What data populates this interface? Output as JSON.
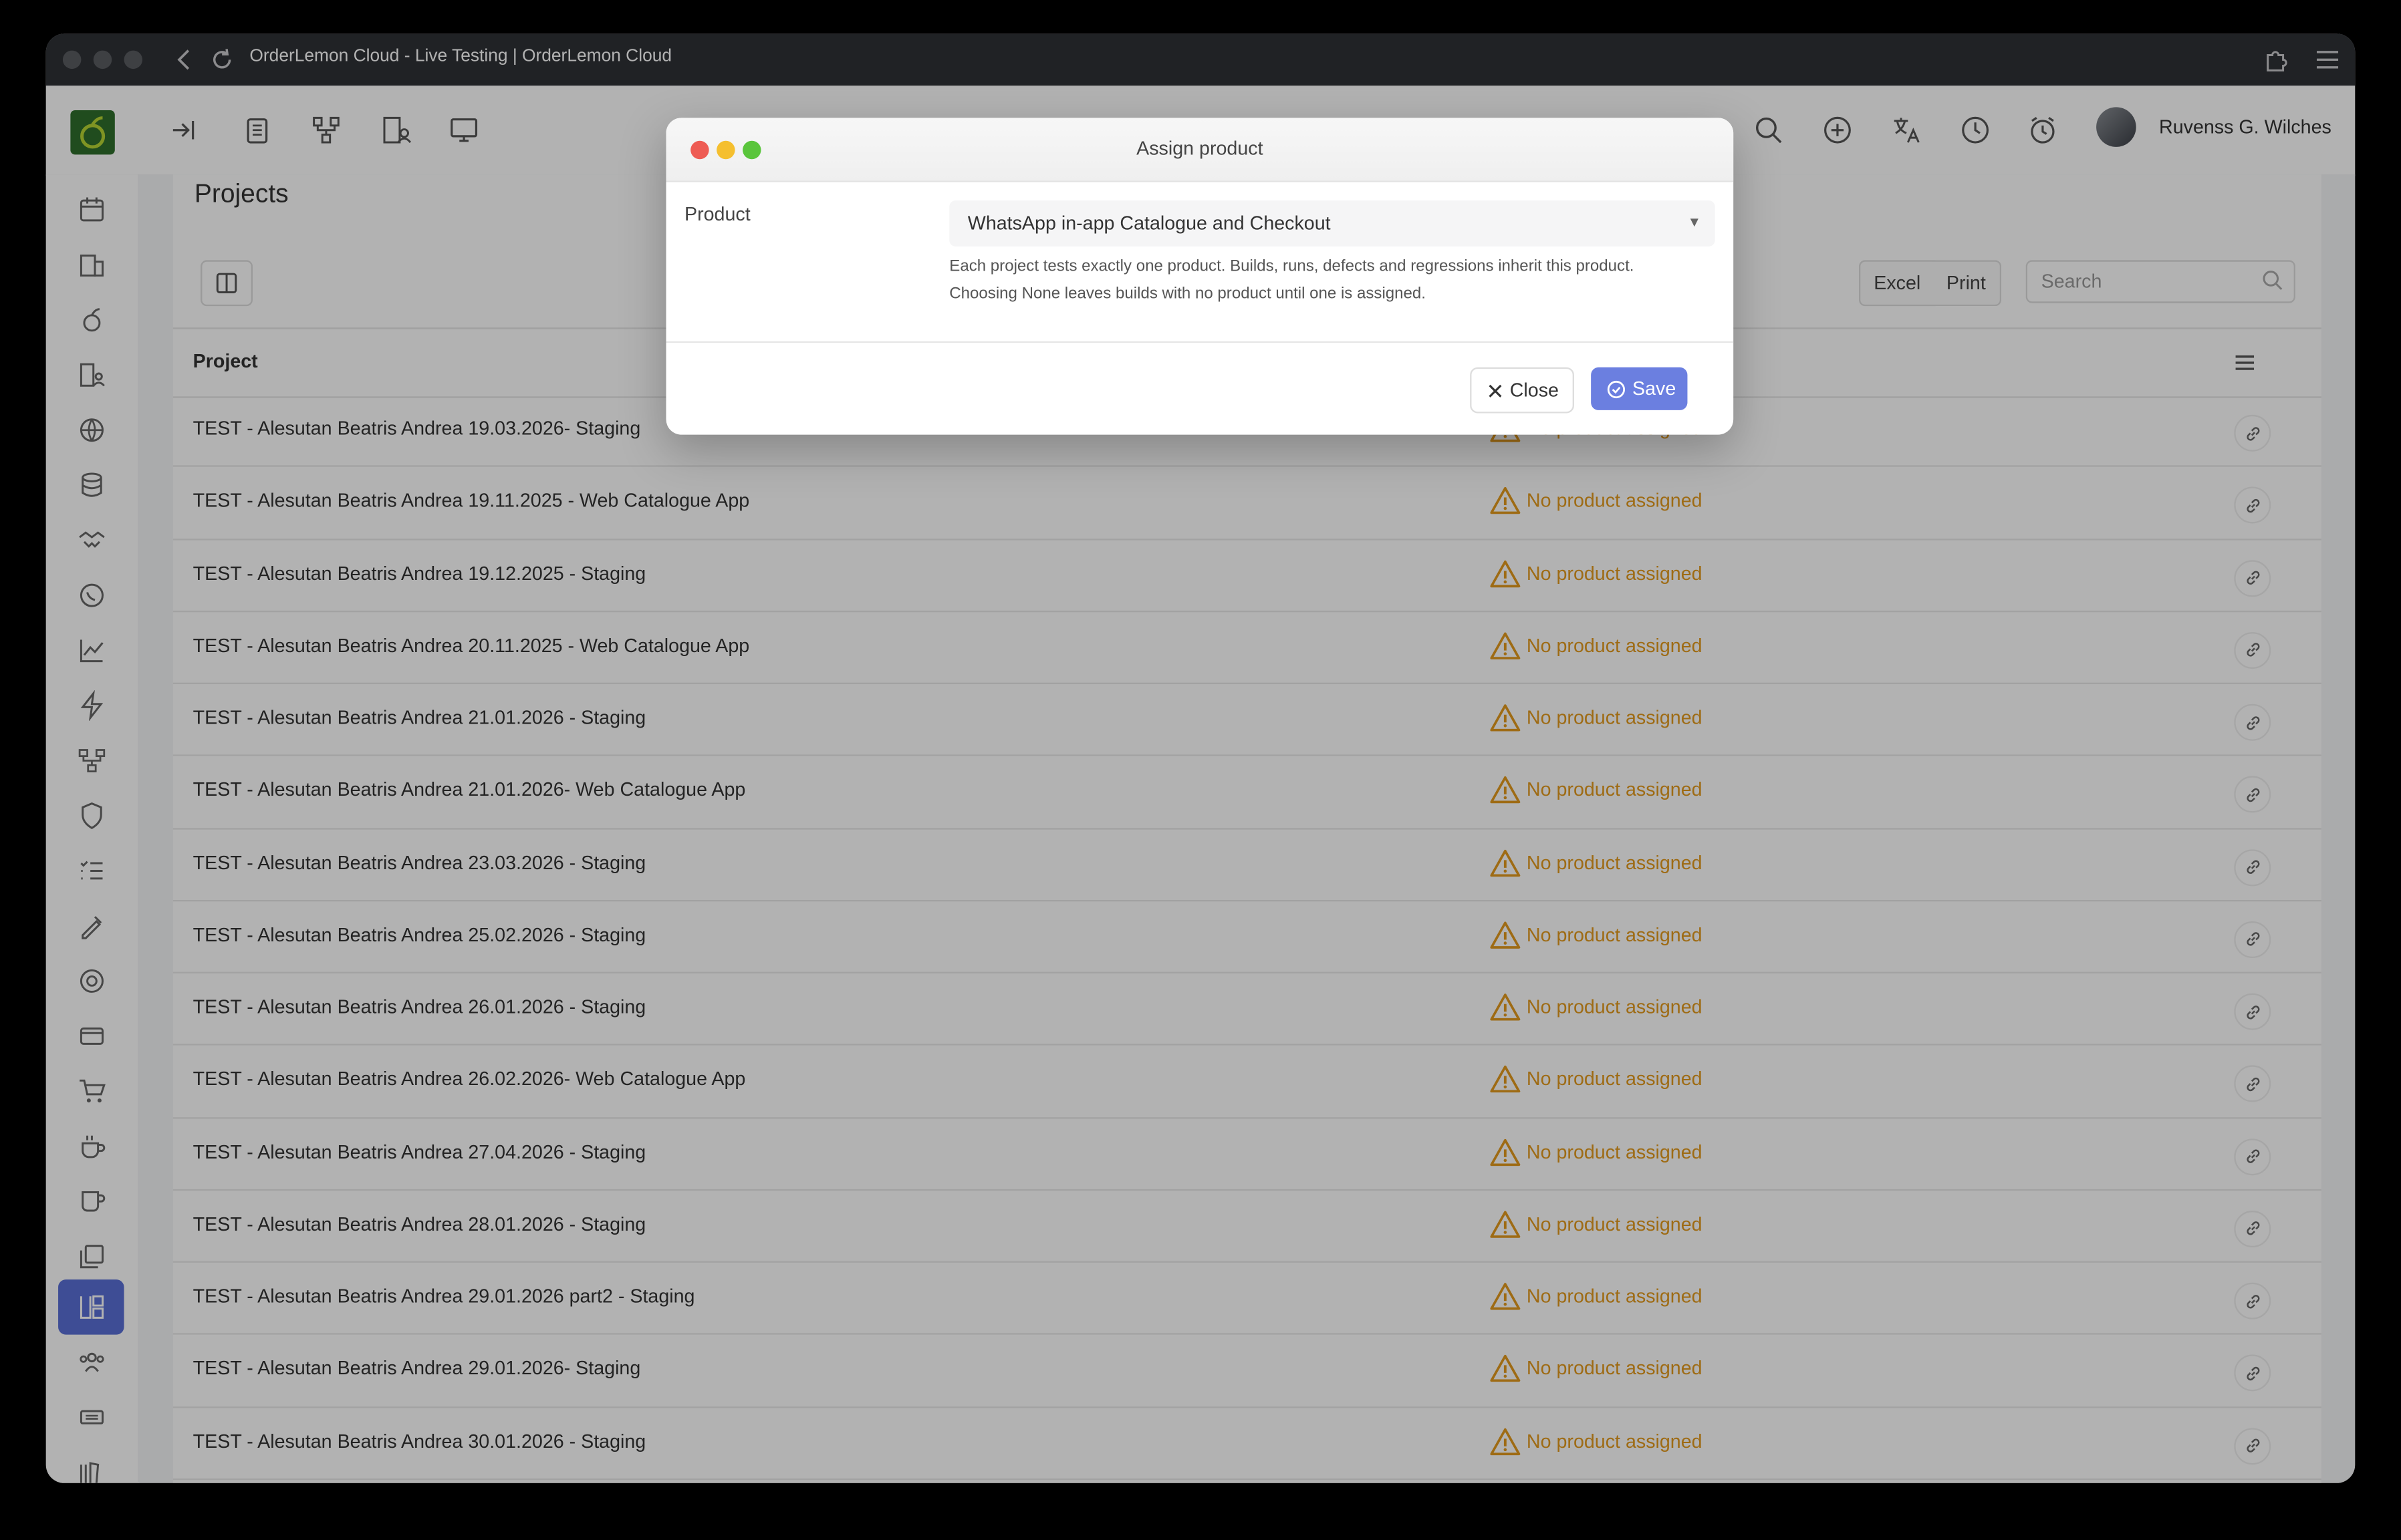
{
  "window": {
    "title": "OrderLemon Cloud - Live Testing | OrderLemon Cloud"
  },
  "header": {
    "user_name": "Ruvenss G. Wilches"
  },
  "page": {
    "title": "Projects",
    "excel_label": "Excel",
    "print_label": "Print",
    "search_placeholder": "Search",
    "column_project": "Project"
  },
  "rows": [
    {
      "project": "TEST - Alesutan Beatris Andrea 19.03.2026- Staging",
      "status": "No product assigned"
    },
    {
      "project": "TEST - Alesutan Beatris Andrea 19.11.2025 - Web Catalogue App",
      "status": "No product assigned"
    },
    {
      "project": "TEST - Alesutan Beatris Andrea 19.12.2025 - Staging",
      "status": "No product assigned"
    },
    {
      "project": "TEST - Alesutan Beatris Andrea 20.11.2025 - Web Catalogue App",
      "status": "No product assigned"
    },
    {
      "project": "TEST - Alesutan Beatris Andrea 21.01.2026 - Staging",
      "status": "No product assigned"
    },
    {
      "project": "TEST - Alesutan Beatris Andrea 21.01.2026- Web Catalogue App",
      "status": "No product assigned"
    },
    {
      "project": "TEST - Alesutan Beatris Andrea 23.03.2026 - Staging",
      "status": "No product assigned"
    },
    {
      "project": "TEST - Alesutan Beatris Andrea 25.02.2026 - Staging",
      "status": "No product assigned"
    },
    {
      "project": "TEST - Alesutan Beatris Andrea 26.01.2026 - Staging",
      "status": "No product assigned"
    },
    {
      "project": "TEST - Alesutan Beatris Andrea 26.02.2026- Web Catalogue App",
      "status": "No product assigned"
    },
    {
      "project": "TEST - Alesutan Beatris Andrea 27.04.2026 - Staging",
      "status": "No product assigned"
    },
    {
      "project": "TEST - Alesutan Beatris Andrea 28.01.2026 - Staging",
      "status": "No product assigned"
    },
    {
      "project": "TEST - Alesutan Beatris Andrea 29.01.2026 part2 - Staging",
      "status": "No product assigned"
    },
    {
      "project": "TEST - Alesutan Beatris Andrea 29.01.2026- Staging",
      "status": "No product assigned"
    },
    {
      "project": "TEST - Alesutan Beatris Andrea 30.01.2026 - Staging",
      "status": "No product assigned"
    }
  ],
  "modal": {
    "title": "Assign product",
    "field_label": "Product",
    "selected_product": "WhatsApp in-app Catalogue and Checkout",
    "help_line1": "Each project tests exactly one product. Builds, runs, defects and regressions inherit this product.",
    "help_line2": "Choosing None leaves builds with no product until one is assigned.",
    "close_label": "Close",
    "save_label": "Save"
  },
  "colors": {
    "accent": "#6b7fe0",
    "warning": "#e39a1e",
    "sidebar_active": "#5a6fd6",
    "logo": "#2f6e2c"
  },
  "icons": [
    "back-icon",
    "reload-icon",
    "extensions-icon",
    "menu-icon",
    "search-icon",
    "add-icon",
    "translate-icon",
    "history-icon",
    "alarm-icon",
    "warning-icon",
    "link-icon",
    "close-icon",
    "save-icon"
  ]
}
